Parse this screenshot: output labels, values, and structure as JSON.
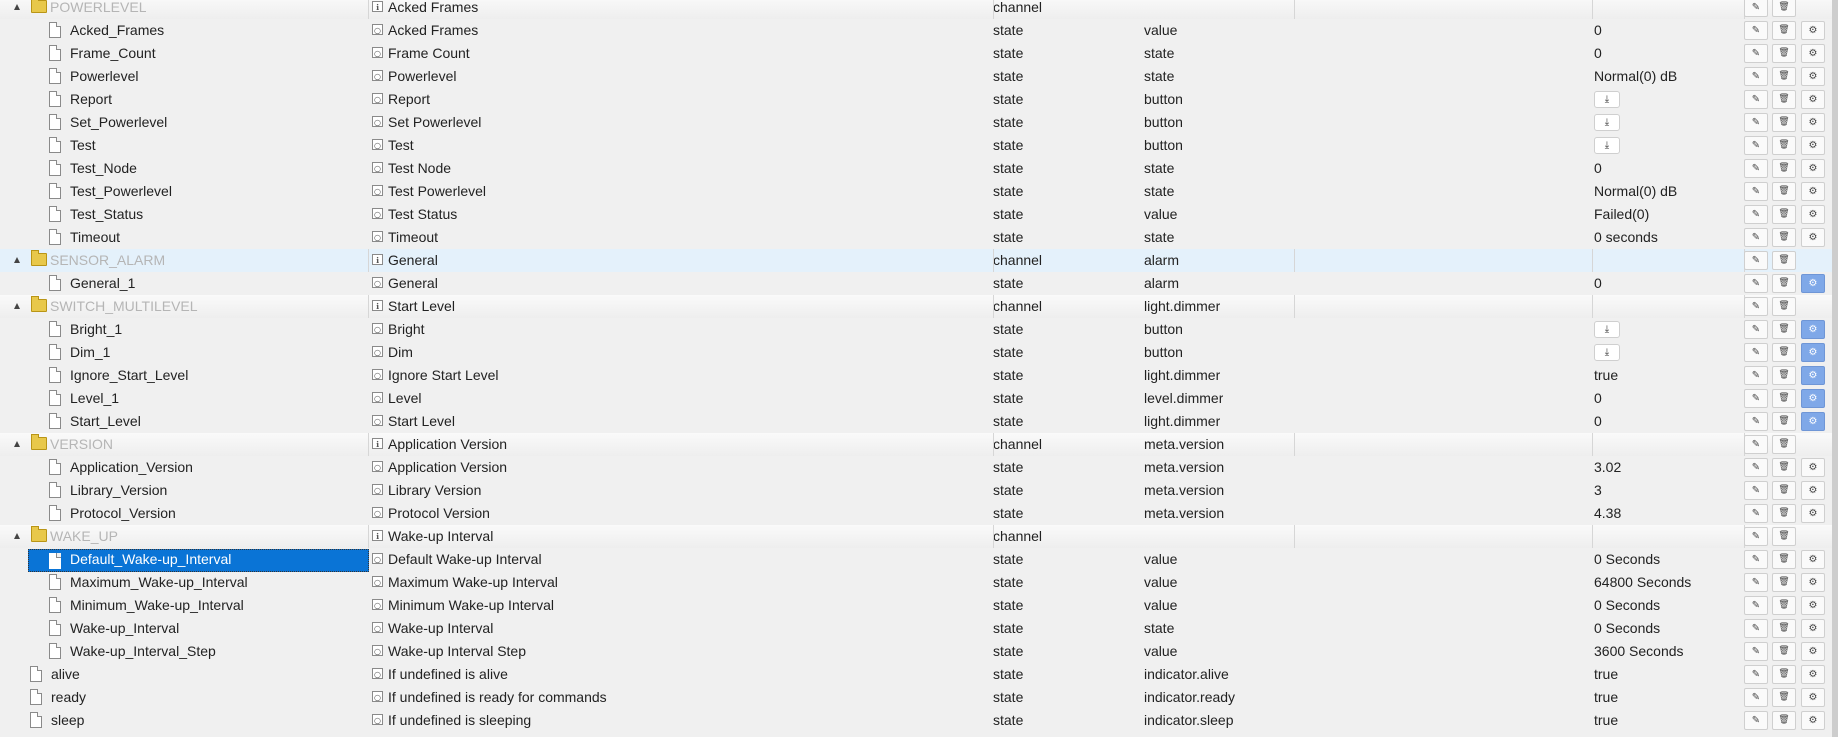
{
  "rows": [
    {
      "kind": "folder",
      "id": "POWERLEVEL",
      "name": "Acked Frames",
      "type": "channel",
      "role": "",
      "value": ""
    },
    {
      "kind": "state",
      "id": "Acked_Frames",
      "name": "Acked Frames",
      "type": "state",
      "role": "value",
      "value": "0"
    },
    {
      "kind": "state",
      "id": "Frame_Count",
      "name": "Frame Count",
      "type": "state",
      "role": "state",
      "value": "0"
    },
    {
      "kind": "state",
      "id": "Powerlevel",
      "name": "Powerlevel",
      "type": "state",
      "role": "state",
      "value": "Normal(0) dB"
    },
    {
      "kind": "state",
      "id": "Report",
      "name": "Report",
      "type": "state",
      "role": "button",
      "button": "download-icon"
    },
    {
      "kind": "state",
      "id": "Set_Powerlevel",
      "name": "Set Powerlevel",
      "type": "state",
      "role": "button",
      "button": "download-icon"
    },
    {
      "kind": "state",
      "id": "Test",
      "name": "Test",
      "type": "state",
      "role": "button",
      "button": "download-icon"
    },
    {
      "kind": "state",
      "id": "Test_Node",
      "name": "Test Node",
      "type": "state",
      "role": "state",
      "value": "0"
    },
    {
      "kind": "state",
      "id": "Test_Powerlevel",
      "name": "Test Powerlevel",
      "type": "state",
      "role": "state",
      "value": "Normal(0) dB"
    },
    {
      "kind": "state",
      "id": "Test_Status",
      "name": "Test Status",
      "type": "state",
      "role": "value",
      "value": "Failed(0)"
    },
    {
      "kind": "state",
      "id": "Timeout",
      "name": "Timeout",
      "type": "state",
      "role": "state",
      "value": "0 seconds"
    },
    {
      "kind": "folder",
      "id": "SENSOR_ALARM",
      "name": "General",
      "type": "channel",
      "role": "alarm",
      "value": "",
      "highlight": true
    },
    {
      "kind": "state",
      "id": "General_1",
      "name": "General",
      "type": "state",
      "role": "alarm",
      "value": "0",
      "active": true
    },
    {
      "kind": "folder",
      "id": "SWITCH_MULTILEVEL",
      "name": "Start Level",
      "type": "channel",
      "role": "light.dimmer",
      "value": ""
    },
    {
      "kind": "state",
      "id": "Bright_1",
      "name": "Bright",
      "type": "state",
      "role": "button",
      "button": "download-icon",
      "active": true
    },
    {
      "kind": "state",
      "id": "Dim_1",
      "name": "Dim",
      "type": "state",
      "role": "button",
      "button": "download-icon",
      "active": true
    },
    {
      "kind": "state",
      "id": "Ignore_Start_Level",
      "name": "Ignore Start Level",
      "type": "state",
      "role": "light.dimmer",
      "value": "true",
      "active": true
    },
    {
      "kind": "state",
      "id": "Level_1",
      "name": "Level",
      "type": "state",
      "role": "level.dimmer",
      "value": "0",
      "active": true
    },
    {
      "kind": "state",
      "id": "Start_Level",
      "name": "Start Level",
      "type": "state",
      "role": "light.dimmer",
      "value": "0",
      "active": true
    },
    {
      "kind": "folder",
      "id": "VERSION",
      "name": "Application Version",
      "type": "channel",
      "role": "meta.version",
      "value": ""
    },
    {
      "kind": "state",
      "id": "Application_Version",
      "name": "Application Version",
      "type": "state",
      "role": "meta.version",
      "value": "3.02"
    },
    {
      "kind": "state",
      "id": "Library_Version",
      "name": "Library Version",
      "type": "state",
      "role": "meta.version",
      "value": "3"
    },
    {
      "kind": "state",
      "id": "Protocol_Version",
      "name": "Protocol Version",
      "type": "state",
      "role": "meta.version",
      "value": "4.38"
    },
    {
      "kind": "folder",
      "id": "WAKE_UP",
      "name": "Wake-up Interval",
      "type": "channel",
      "role": "",
      "value": ""
    },
    {
      "kind": "state",
      "id": "Default_Wake-up_Interval",
      "name": "Default Wake-up Interval",
      "type": "state",
      "role": "value",
      "value": "0 Seconds",
      "selected": true
    },
    {
      "kind": "state",
      "id": "Maximum_Wake-up_Interval",
      "name": "Maximum Wake-up Interval",
      "type": "state",
      "role": "value",
      "value": "64800 Seconds"
    },
    {
      "kind": "state",
      "id": "Minimum_Wake-up_Interval",
      "name": "Minimum Wake-up Interval",
      "type": "state",
      "role": "value",
      "value": "0 Seconds"
    },
    {
      "kind": "state",
      "id": "Wake-up_Interval",
      "name": "Wake-up Interval",
      "type": "state",
      "role": "state",
      "value": "0 Seconds"
    },
    {
      "kind": "state",
      "id": "Wake-up_Interval_Step",
      "name": "Wake-up Interval Step",
      "type": "state",
      "role": "value",
      "value": "3600 Seconds"
    },
    {
      "kind": "root",
      "id": "alive",
      "name": "If undefined is alive",
      "type": "state",
      "role": "indicator.alive",
      "value": "true"
    },
    {
      "kind": "root",
      "id": "ready",
      "name": "If undefined is ready for commands",
      "type": "state",
      "role": "indicator.ready",
      "value": "true"
    },
    {
      "kind": "root",
      "id": "sleep",
      "name": "If undefined is sleeping",
      "type": "state",
      "role": "indicator.sleep",
      "value": "true"
    }
  ],
  "icons": {
    "folder": "folder-icon",
    "object": "file-icon",
    "channel_name": "info-icon",
    "state_name": "state-icon",
    "edit": "pencil-icon",
    "delete": "trash-icon",
    "settings": "gear-icon",
    "button": "download-icon"
  },
  "colors": {
    "selection": "#0a74d6",
    "active_settings": "#7fa8e8",
    "folder_id_text": "#b5b5b5",
    "highlight_row": "#e4f1fb"
  }
}
